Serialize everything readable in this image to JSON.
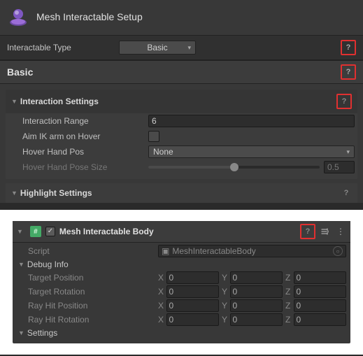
{
  "header": {
    "title": "Mesh Interactable Setup"
  },
  "type_row": {
    "label": "Interactable Type",
    "value": "Basic"
  },
  "basic": {
    "title": "Basic"
  },
  "interaction": {
    "title": "Interaction Settings",
    "range_label": "Interaction Range",
    "range_value": "6",
    "aim_label": "Aim IK arm on Hover",
    "hover_pos_label": "Hover Hand Pos",
    "hover_pos_value": "None",
    "hover_size_label": "Hover Hand Pose Size",
    "hover_size_value": "0.5"
  },
  "highlight": {
    "title": "Highlight Settings"
  },
  "component": {
    "title": "Mesh Interactable Body",
    "script_label": "Script",
    "script_value": "MeshInteractableBody",
    "debug_label": "Debug Info",
    "settings_label": "Settings",
    "vectors": {
      "target_position": {
        "label": "Target Position",
        "x": "0",
        "y": "0",
        "z": "0"
      },
      "target_rotation": {
        "label": "Target Rotation",
        "x": "0",
        "y": "0",
        "z": "0"
      },
      "ray_hit_position": {
        "label": "Ray Hit Position",
        "x": "0",
        "y": "0",
        "z": "0"
      },
      "ray_hit_rotation": {
        "label": "Ray Hit Rotation",
        "x": "0",
        "y": "0",
        "z": "0"
      }
    },
    "axes": {
      "x": "X",
      "y": "Y",
      "z": "Z"
    }
  },
  "icons": {
    "help": "?",
    "chev": "▾",
    "fold_open": "▼",
    "sliders": "≡",
    "kebab": "⋮",
    "script_badge": "#",
    "obj_dot": "○",
    "script_glyph": "▣"
  }
}
